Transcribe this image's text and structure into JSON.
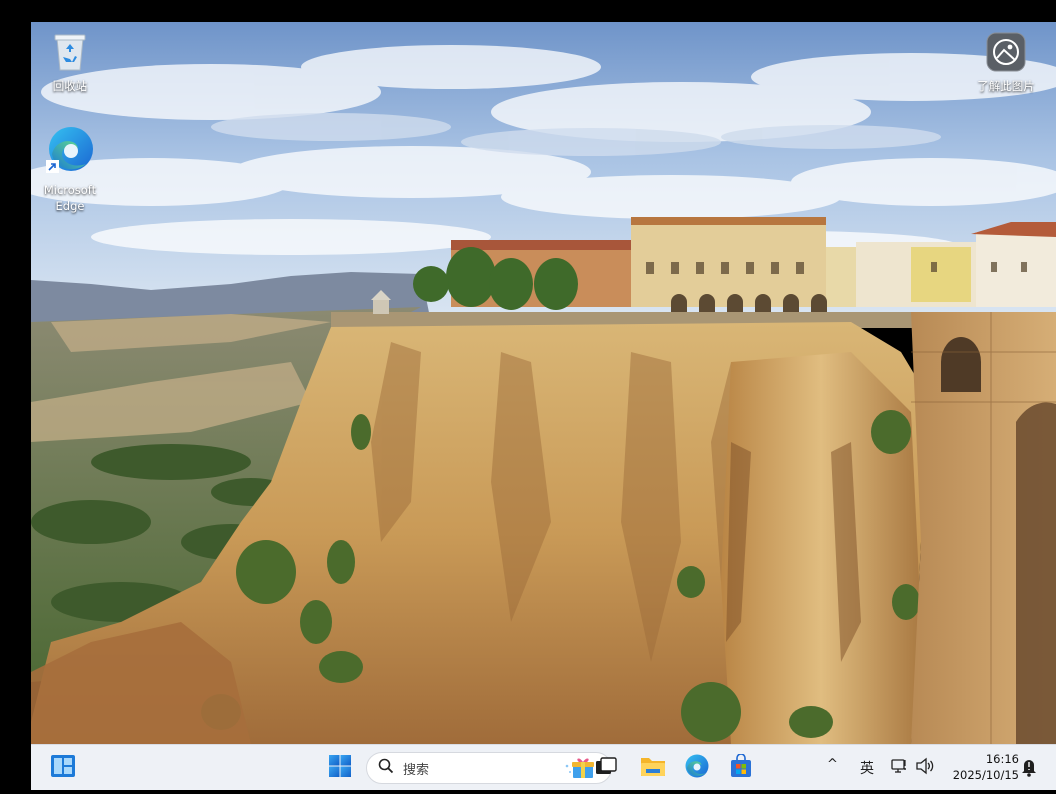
{
  "desktop": {
    "icons": [
      {
        "label": "回收站",
        "icon": "recycle-bin-icon"
      },
      {
        "label": "Microsoft\nEdge",
        "line1": "Microsoft",
        "line2": "Edge",
        "icon": "edge-icon"
      },
      {
        "label": "了解此图片",
        "icon": "learn-about-picture-icon"
      }
    ]
  },
  "taskbar": {
    "search_placeholder": "搜索",
    "apps": [
      "widgets-icon",
      "start-icon",
      "task-view-icon",
      "file-explorer-icon",
      "edge-icon",
      "microsoft-store-icon"
    ],
    "tray": {
      "chevron": "^",
      "ime": "英",
      "time": "16:16",
      "date": "2025/10/15"
    }
  },
  "colors": {
    "taskbar_bg": "#eef1f6",
    "accent": "#1b66d2"
  }
}
